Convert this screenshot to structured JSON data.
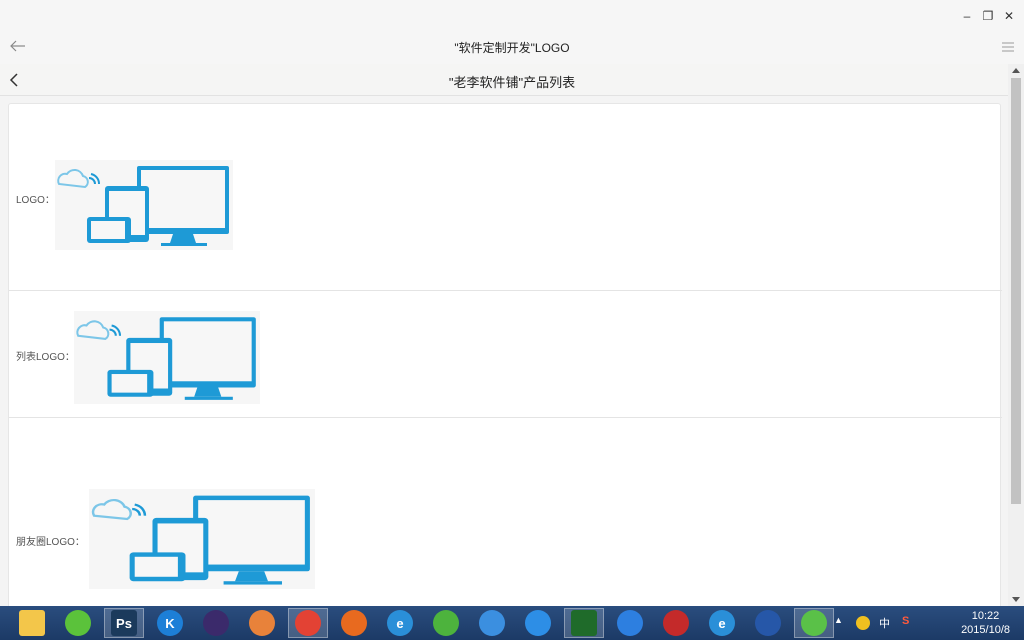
{
  "window": {
    "title": "\"软件定制开发\"LOGO",
    "controls": {
      "minimize": "–",
      "restore": "❐",
      "close": "✕"
    }
  },
  "nav": {
    "title": "\"老李软件铺\"产品列表"
  },
  "rows": [
    {
      "label": "LOGO："
    },
    {
      "label": "列表LOGO："
    },
    {
      "label": "朋友圈LOGO："
    }
  ],
  "logo_colors": {
    "device": "#1e9ad6",
    "cloud": "#7cc6e8",
    "screen": "#f7f7f7"
  },
  "taskbar": {
    "apps": [
      {
        "name": "file-explorer-icon",
        "color": "#f3c64a"
      },
      {
        "name": "app-green-leaf-icon",
        "color": "#5bc23b"
      },
      {
        "name": "photoshop-icon",
        "color": "#1b3a5c",
        "label": "Ps"
      },
      {
        "name": "kugou-icon",
        "color": "#1d7fd7",
        "label": "K"
      },
      {
        "name": "eclipse-icon",
        "color": "#3b2a6b"
      },
      {
        "name": "app-colorful-icon",
        "color": "#e8823a"
      },
      {
        "name": "chrome-icon",
        "color": "#e34234"
      },
      {
        "name": "firefox-icon",
        "color": "#e86a1f"
      },
      {
        "name": "ie-icon",
        "color": "#2a8fd8",
        "label": "e"
      },
      {
        "name": "app-arrow-icon",
        "color": "#4db33d"
      },
      {
        "name": "cloud-drive-icon",
        "color": "#3b8fe0"
      },
      {
        "name": "baidu-netdisk-icon",
        "color": "#2d8ee6"
      },
      {
        "name": "eye-app-icon",
        "color": "#1f6b2a"
      },
      {
        "name": "pen-app-icon",
        "color": "#2d7fe0"
      },
      {
        "name": "tool-app-icon",
        "color": "#c42a2a"
      },
      {
        "name": "ie-icon-2",
        "color": "#2a8fd8",
        "label": "e"
      },
      {
        "name": "remote-desktop-icon",
        "color": "#2657a8"
      },
      {
        "name": "wechat-icon",
        "color": "#5ac148"
      }
    ],
    "tray": {
      "ime": "中",
      "sogou": "S",
      "time": "10:22",
      "date": "2015/10/8"
    }
  }
}
